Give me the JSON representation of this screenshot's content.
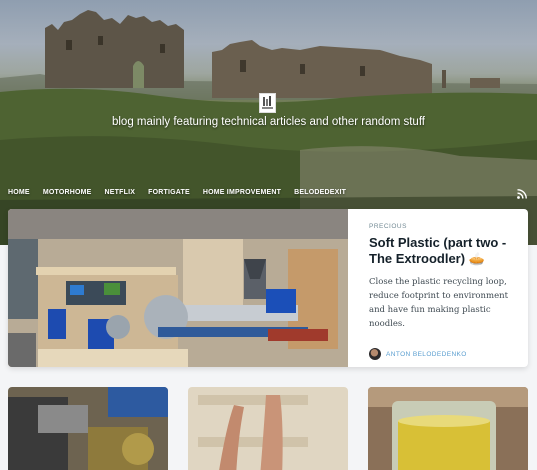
{
  "site": {
    "tagline": "blog mainly featuring technical articles and other random stuff"
  },
  "nav": {
    "items": [
      {
        "label": "HOME"
      },
      {
        "label": "MOTORHOME"
      },
      {
        "label": "NETFLIX"
      },
      {
        "label": "FORTIGATE"
      },
      {
        "label": "HOME IMPROVEMENT"
      },
      {
        "label": "BELODEDEXIT"
      }
    ],
    "rss_icon": "rss-icon"
  },
  "featured": {
    "tag": "PRECIOUS",
    "title": "Soft Plastic (part two - The Extroodler) 🥧",
    "excerpt": "Close the plastic recycling loop, reduce footprint to environment and have fun making plastic noodles.",
    "author": "ANTON BELODEDENKO"
  },
  "colors": {
    "accent": "#5a9ed0",
    "title": "#15212a",
    "background": "#f4f5f7"
  }
}
